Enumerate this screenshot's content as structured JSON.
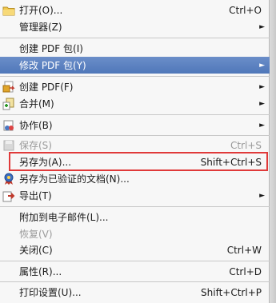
{
  "menu": {
    "items": [
      {
        "label": "打开(O)...",
        "shortcut": "Ctrl+O",
        "icon": "folder-icon"
      },
      {
        "label": "管理器(Z)",
        "arrow": "►"
      },
      {
        "label": "创建 PDF 包(I)"
      },
      {
        "label": "修改 PDF 包(Y)",
        "arrow": "►"
      },
      {
        "label": "创建 PDF(F)",
        "arrow": "►",
        "icon": "create-pdf-icon"
      },
      {
        "label": "合并(M)",
        "arrow": "►",
        "icon": "merge-icon"
      },
      {
        "label": "协作(B)",
        "arrow": "►",
        "icon": "collaborate-icon"
      },
      {
        "label": "保存(S)",
        "shortcut": "Ctrl+S",
        "icon": "save-icon"
      },
      {
        "label": "另存为(A)...",
        "shortcut": "Shift+Ctrl+S"
      },
      {
        "label": "另存为已验证的文档(N)...",
        "icon": "certified-ribbon-icon"
      },
      {
        "label": "导出(T)",
        "arrow": "►",
        "icon": "export-icon"
      },
      {
        "label": "附加到电子邮件(L)..."
      },
      {
        "label": "恢复(V)"
      },
      {
        "label": "关闭(C)",
        "shortcut": "Ctrl+W"
      },
      {
        "label": "属性(R)...",
        "shortcut": "Ctrl+D"
      },
      {
        "label": "打印设置(U)...",
        "shortcut": "Shift+Ctrl+P"
      }
    ]
  }
}
